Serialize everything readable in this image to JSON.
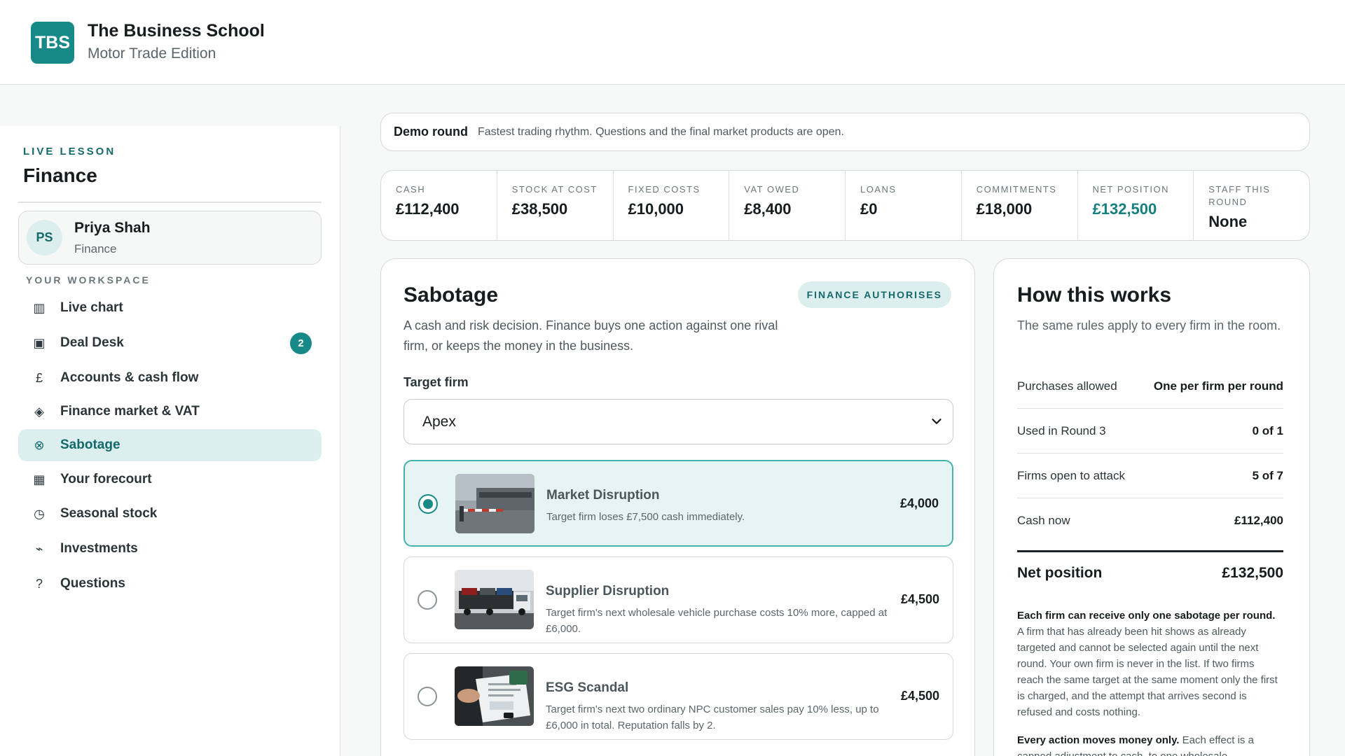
{
  "brand": {
    "logo": "TBS",
    "title": "The Business School",
    "subtitle": "Motor Trade Edition"
  },
  "sidebar": {
    "eyebrow": "LIVE LESSON",
    "lesson": "Finance",
    "profile": {
      "initials": "PS",
      "name": "Priya Shah",
      "role": "Finance"
    },
    "workspace_label": "YOUR WORKSPACE",
    "items": [
      {
        "icon": "bar-chart-icon",
        "glyph": "▥",
        "label": "Live chart"
      },
      {
        "icon": "deal-desk-icon",
        "glyph": "▣",
        "label": "Deal Desk",
        "badge": "2"
      },
      {
        "icon": "pound-icon",
        "glyph": "£",
        "label": "Accounts & cash flow"
      },
      {
        "icon": "diamond-icon",
        "glyph": "◈",
        "label": "Finance market & VAT"
      },
      {
        "icon": "sabotage-icon",
        "glyph": "⊗",
        "label": "Sabotage",
        "active": true
      },
      {
        "icon": "grid-icon",
        "glyph": "▦",
        "label": "Your forecourt"
      },
      {
        "icon": "clock-icon",
        "glyph": "◷",
        "label": "Seasonal stock"
      },
      {
        "icon": "trend-icon",
        "glyph": "⌁",
        "label": "Investments"
      },
      {
        "icon": "question-icon",
        "glyph": "?",
        "label": "Questions"
      }
    ]
  },
  "round": {
    "name": "Demo round",
    "description": "Fastest trading rhythm. Questions and the final market products are open."
  },
  "stats": [
    {
      "label": "CASH",
      "value": "£112,400"
    },
    {
      "label": "STOCK AT COST",
      "value": "£38,500"
    },
    {
      "label": "FIXED COSTS",
      "value": "£10,000"
    },
    {
      "label": "VAT OWED",
      "value": "£8,400"
    },
    {
      "label": "LOANS",
      "value": "£0"
    },
    {
      "label": "COMMITMENTS",
      "value": "£18,000"
    },
    {
      "label": "NET POSITION",
      "value": "£132,500",
      "accent": true
    },
    {
      "label": "STAFF THIS ROUND",
      "value": "None"
    }
  ],
  "sabotage": {
    "title": "Sabotage",
    "pill": "FINANCE AUTHORISES",
    "description": "A cash and risk decision. Finance buys one action against one rival firm, or keeps the money in the business.",
    "target_label": "Target firm",
    "target_value": "Apex",
    "options": [
      {
        "title": "Market Disruption",
        "description": "Target firm loses £7,500 cash immediately.",
        "price": "£4,000",
        "selected": true
      },
      {
        "title": "Supplier Disruption",
        "description": "Target firm's next wholesale vehicle purchase costs 10% more, capped at £6,000.",
        "price": "£4,500",
        "selected": false
      },
      {
        "title": "ESG Scandal",
        "description": "Target firm's next two ordinary NPC customer sales pay 10% less, up to £6,000 in total. Reputation falls by 2.",
        "price": "£4,500",
        "selected": false
      }
    ]
  },
  "how": {
    "title": "How this works",
    "description": "The same rules apply to every firm in the room.",
    "rows": [
      {
        "key": "Purchases allowed",
        "value": "One per firm per round"
      },
      {
        "key": "Used in Round 3",
        "value": "0 of 1"
      },
      {
        "key": "Firms open to attack",
        "value": "5 of 7"
      },
      {
        "key": "Cash now",
        "value": "£112,400"
      }
    ],
    "net_label": "Net position",
    "net_value": "£132,500",
    "note1_bold": "Each firm can receive only one sabotage per round.",
    "note1_rest": " A firm that has already been hit shows as already targeted and cannot be selected again until the next round. Your own firm is never in the list. If two firms reach the same target at the same moment only the first is charged, and the attempt that arrives second is refused and costs nothing.",
    "note2_bold": "Every action moves money only.",
    "note2_rest": " Each effect is a capped adjustment to cash, to one wholesale"
  }
}
